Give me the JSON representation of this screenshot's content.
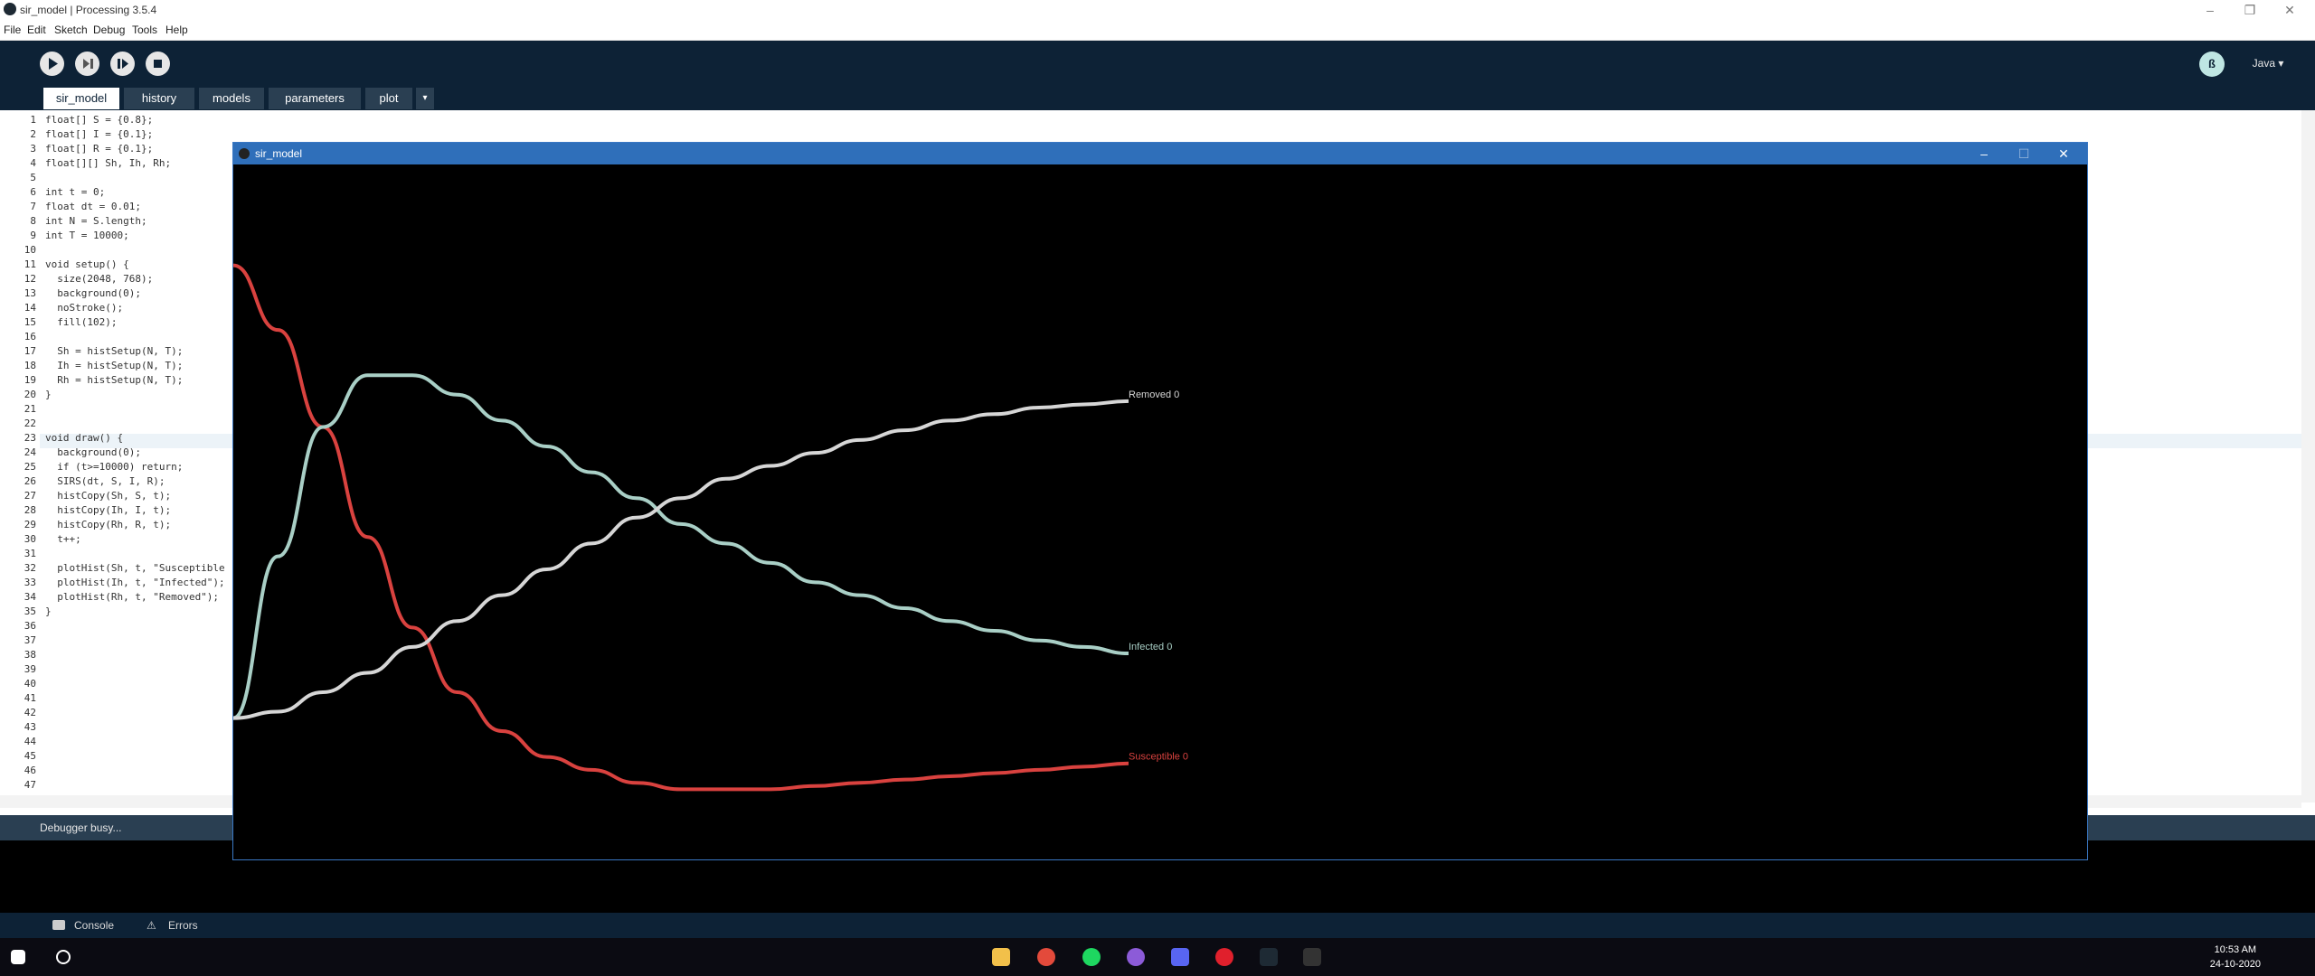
{
  "window": {
    "title": "sir_model | Processing 3.5.4"
  },
  "menu": [
    "File",
    "Edit",
    "Sketch",
    "Debug",
    "Tools",
    "Help"
  ],
  "toolbar": {
    "mode": "Java ▾",
    "mode_icon": "ß"
  },
  "tabs": [
    "sir_model",
    "history",
    "models",
    "parameters",
    "plot"
  ],
  "code_lines": [
    "float[] S = {0.8};",
    "float[] I = {0.1};",
    "float[] R = {0.1};",
    "float[][] Sh, Ih, Rh;",
    "",
    "int t = 0;",
    "float dt = 0.01;",
    "int N = S.length;",
    "int T = 10000;",
    "",
    "void setup() {",
    "  size(2048, 768);",
    "  background(0);",
    "  noStroke();",
    "  fill(102);",
    "",
    "  Sh = histSetup(N, T);",
    "  Ih = histSetup(N, T);",
    "  Rh = histSetup(N, T);",
    "}",
    "",
    "",
    "void draw() {",
    "  background(0);",
    "  if (t>=10000) return;",
    "  SIRS(dt, S, I, R);",
    "  histCopy(Sh, S, t);",
    "  histCopy(Ih, I, t);",
    "  histCopy(Rh, R, t);",
    "  t++;",
    "",
    "  plotHist(Sh, t, \"Susceptible",
    "  plotHist(Ih, t, \"Infected\");",
    "  plotHist(Rh, t, \"Removed\");",
    "}",
    "",
    "",
    "",
    "",
    "",
    "",
    "",
    "",
    "",
    "",
    "",
    ""
  ],
  "status": "Debugger busy...",
  "console_tabs": [
    "Console",
    "Errors"
  ],
  "sketch": {
    "title": "sir_model",
    "labels": {
      "removed": "Removed 0",
      "infected": "Infected 0",
      "susceptible": "Susceptible 0"
    },
    "colors": {
      "susceptible": "#d9423f",
      "infected": "#a9cfc6",
      "removed": "#d6d6d6"
    }
  },
  "chart_data": {
    "type": "line",
    "x": [
      0,
      1,
      2,
      3,
      4,
      5,
      6,
      7,
      8,
      9,
      10,
      11,
      12,
      13,
      14,
      15,
      16,
      17,
      18,
      19,
      20
    ],
    "series": [
      {
        "name": "Susceptible 0",
        "values": [
          0.8,
          0.7,
          0.55,
          0.38,
          0.24,
          0.14,
          0.08,
          0.04,
          0.02,
          0.0,
          -0.01,
          -0.01,
          -0.01,
          -0.005,
          0.0,
          0.005,
          0.01,
          0.015,
          0.02,
          0.025,
          0.03
        ]
      },
      {
        "name": "Infected 0",
        "values": [
          0.1,
          0.35,
          0.55,
          0.63,
          0.63,
          0.6,
          0.56,
          0.52,
          0.48,
          0.44,
          0.4,
          0.37,
          0.34,
          0.31,
          0.29,
          0.27,
          0.25,
          0.235,
          0.22,
          0.21,
          0.2
        ]
      },
      {
        "name": "Removed 0",
        "values": [
          0.1,
          0.11,
          0.14,
          0.17,
          0.21,
          0.25,
          0.29,
          0.33,
          0.37,
          0.41,
          0.44,
          0.47,
          0.49,
          0.51,
          0.53,
          0.545,
          0.56,
          0.57,
          0.58,
          0.585,
          0.59
        ]
      }
    ],
    "ylim": [
      -0.05,
      0.9
    ]
  }
}
